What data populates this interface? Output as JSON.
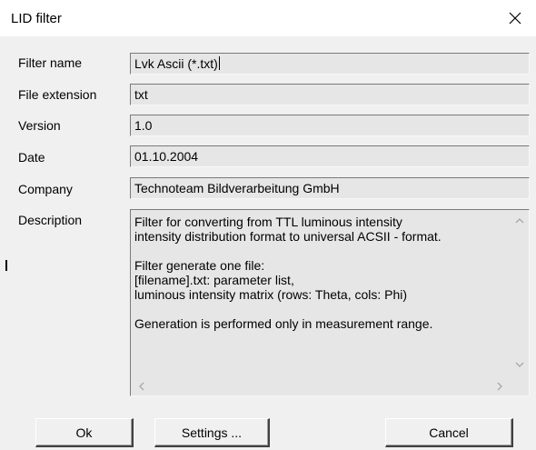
{
  "window": {
    "title": "LID filter"
  },
  "fields": [
    {
      "label": "Filter name",
      "value": "Lvk Ascii (*.txt)"
    },
    {
      "label": "File extension",
      "value": "txt"
    },
    {
      "label": "Version",
      "value": "1.0"
    },
    {
      "label": "Date",
      "value": "01.10.2004"
    },
    {
      "label": "Company",
      "value": "Technoteam Bildverarbeitung GmbH"
    }
  ],
  "description": {
    "label": "Description",
    "lines": [
      "Filter for converting from TTL luminous intensity",
      "intensity distribution format to universal ACSII - format.",
      "",
      "Filter generate one file:",
      "[filename].txt: parameter list,",
      "luminous intensity matrix (rows: Theta, cols: Phi)",
      "",
      "Generation is performed only in measurement range."
    ]
  },
  "buttons": {
    "ok": "Ok",
    "settings": "Settings ...",
    "cancel": "Cancel"
  },
  "icons": {
    "close": "close-icon",
    "scroll_up": "chevron-up-icon",
    "scroll_down": "chevron-down-icon",
    "scroll_left": "chevron-left-icon",
    "scroll_right": "chevron-right-icon"
  },
  "colors": {
    "field_background": "#e6e6e6",
    "dialog_background": "#f0f0f0",
    "titlebar_background": "#ffffff"
  }
}
